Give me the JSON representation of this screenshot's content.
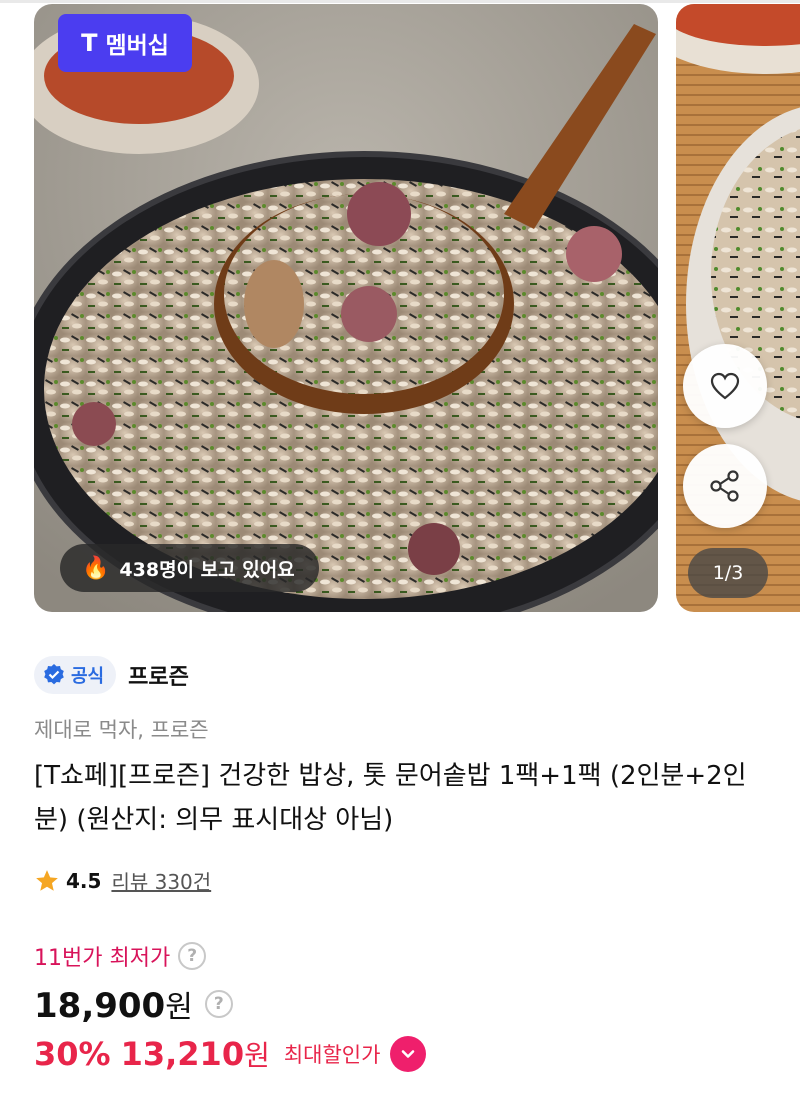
{
  "product_image": {
    "membership_badge": {
      "t_mark": "T",
      "label": "멤버십"
    },
    "viewers": {
      "icon": "fire-icon",
      "text": "438명이 보고 있어요"
    },
    "counter": "1/3",
    "actions": {
      "like_icon": "heart-icon",
      "share_icon": "share-icon"
    }
  },
  "seller": {
    "badge_icon": "verified-check-icon",
    "badge_label": "공식",
    "name": "프로즌"
  },
  "tagline": "제대로 먹자, 프로즌",
  "title": "[T쇼페][프로즌] 건강한 밥상, 톳 문어솥밥 1팩+1팩 (2인분+2인분) (원산지: 의무 표시대상 아님)",
  "rating": {
    "icon": "star-icon",
    "score": "4.5",
    "review_text": "리뷰 330건"
  },
  "price": {
    "lowest_label": "11번가 최저가",
    "help_mark": "?",
    "original": "18,900",
    "unit": "원",
    "discount_rate": "30%",
    "sale": "13,210",
    "max_discount_label": "최대할인가",
    "expand_icon": "chevron-down-icon"
  },
  "colors": {
    "membership": "#4b3df0",
    "accent": "#e8254a",
    "lowest": "#d8135a",
    "official": "#2a6be0",
    "star": "#f5a623"
  }
}
